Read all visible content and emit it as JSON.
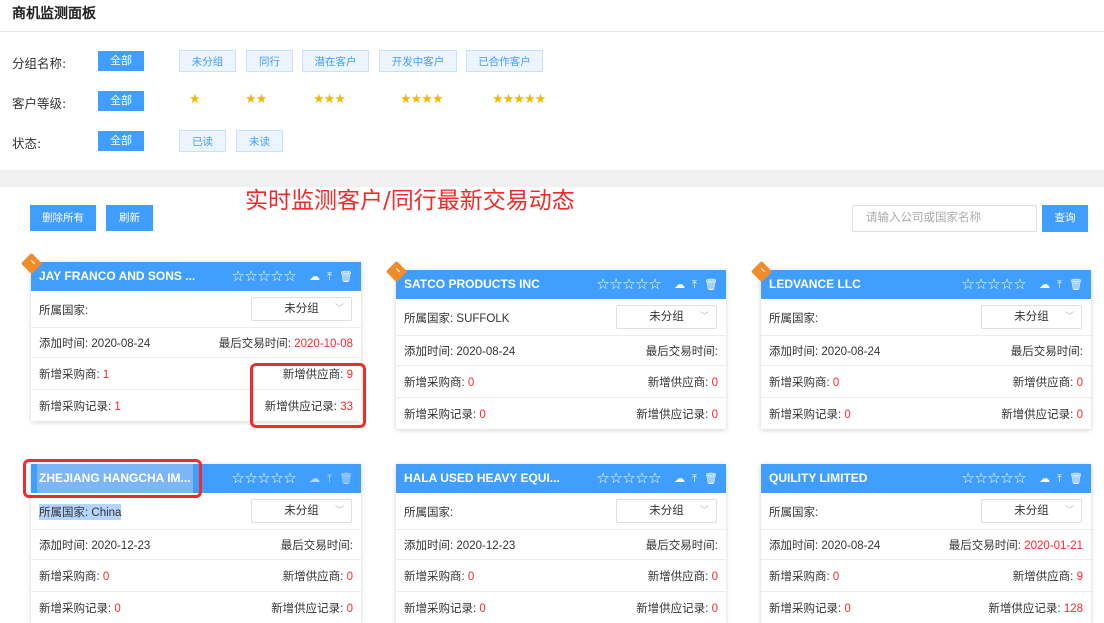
{
  "page_title": "商机监测面板",
  "filters": {
    "group": {
      "label": "分组名称:",
      "all": "全部",
      "options": [
        "未分组",
        "同行",
        "潜在客户",
        "开发中客户",
        "已合作客户"
      ]
    },
    "level": {
      "label": "客户等级:",
      "all": "全部",
      "options": [
        "★",
        "★★",
        "★★★",
        "★★★★",
        "★★★★★"
      ]
    },
    "status": {
      "label": "状态:",
      "all": "全部",
      "options": [
        "已读",
        "未读"
      ]
    }
  },
  "banner": "实时监测客户/同行最新交易动态",
  "toolbar": {
    "delete_all": "删除所有",
    "refresh": "刷新",
    "search_placeholder": "请输入公司或国家名称",
    "search": "查询"
  },
  "card_labels": {
    "stars": "☆☆☆☆☆",
    "country": "所属国家:",
    "add_time": "添加时间:",
    "last_trade": "最后交易时间:",
    "new_buyers": "新增采购商:",
    "new_suppliers": "新增供应商:",
    "new_buy_records": "新增采购记录:",
    "new_supply_records": "新增供应记录:",
    "group_select": "未分组"
  },
  "cards": [
    {
      "name": "JAY FRANCO AND SONS ...",
      "country": "",
      "add_date": "2020-08-24",
      "last_trade": "2020-10-08",
      "buyers": "1",
      "suppliers": "9",
      "buy_records": "1",
      "supply_records": "33"
    },
    {
      "name": "SATCO PRODUCTS INC",
      "country": "SUFFOLK",
      "add_date": "2020-08-24",
      "last_trade": "",
      "buyers": "0",
      "suppliers": "0",
      "buy_records": "0",
      "supply_records": "0"
    },
    {
      "name": "LEDVANCE LLC",
      "country": "",
      "add_date": "2020-08-24",
      "last_trade": "",
      "buyers": "0",
      "suppliers": "0",
      "buy_records": "0",
      "supply_records": "0"
    },
    {
      "name": "ZHEJIANG HANGCHA IM...",
      "country": "China",
      "add_date": "2020-12-23",
      "last_trade": "",
      "buyers": "0",
      "suppliers": "0",
      "buy_records": "0",
      "supply_records": "0"
    },
    {
      "name": "HALA USED HEAVY EQUI...",
      "country": "",
      "add_date": "2020-12-23",
      "last_trade": "",
      "buyers": "0",
      "suppliers": "0",
      "buy_records": "0",
      "supply_records": "0"
    },
    {
      "name": "QUILITY LIMITED",
      "country": "",
      "add_date": "2020-08-24",
      "last_trade": "2020-01-21",
      "buyers": "0",
      "suppliers": "9",
      "buy_records": "0",
      "supply_records": "128"
    }
  ],
  "colors": {
    "accent": "#409eff",
    "highlight_red": "#f42a2a",
    "tag_orange": "#f08c2a"
  }
}
